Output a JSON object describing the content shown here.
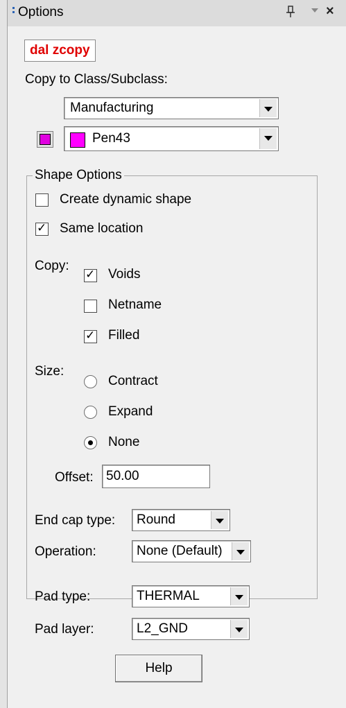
{
  "panel": {
    "title": "Options",
    "command": "dal zcopy"
  },
  "copy_to": {
    "label": "Copy to Class/Subclass:",
    "class_value": "Manufacturing",
    "subclass_value": "Pen43",
    "swatch_color": "#ff00ff"
  },
  "shape_options": {
    "group_label": "Shape Options",
    "create_dynamic_shape": {
      "label": "Create dynamic shape",
      "checked": false
    },
    "same_location": {
      "label": "Same location",
      "checked": true
    },
    "copy_label": "Copy:",
    "copy_items": [
      {
        "label": "Voids",
        "checked": true
      },
      {
        "label": "Netname",
        "checked": false
      },
      {
        "label": "Filled",
        "checked": true
      }
    ],
    "size_label": "Size:",
    "size_items": [
      {
        "label": "Contract",
        "selected": false
      },
      {
        "label": "Expand",
        "selected": false
      },
      {
        "label": "None",
        "selected": true
      }
    ],
    "offset_label": "Offset:",
    "offset_value": "50.00",
    "end_cap_label": "End cap type:",
    "end_cap_value": "Round",
    "operation_label": "Operation:",
    "operation_value": "None (Default)",
    "pad_type_label": "Pad type:",
    "pad_type_value": "THERMAL",
    "pad_layer_label": "Pad layer:",
    "pad_layer_value": "L2_GND"
  },
  "help_button": "Help",
  "icons": {
    "pin": "pin-icon",
    "menu": "dropdown-arrow-icon",
    "close": "close-icon"
  }
}
